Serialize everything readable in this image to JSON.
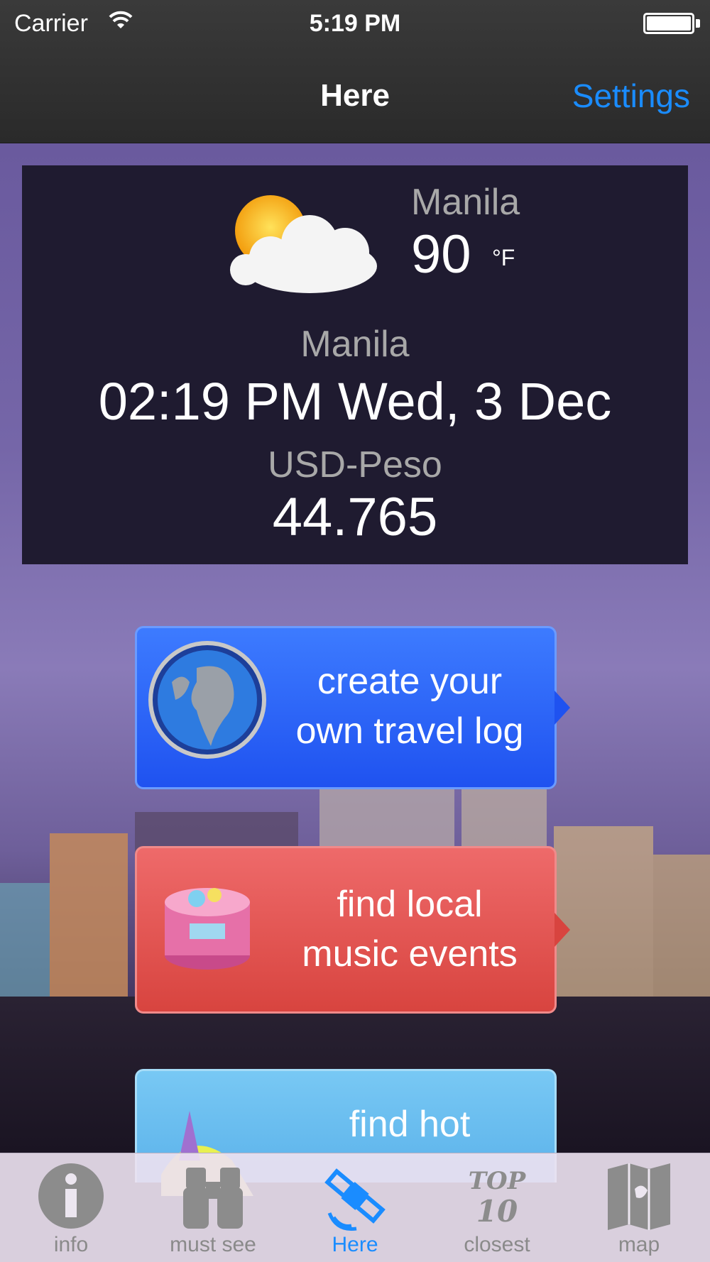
{
  "status_bar": {
    "carrier": "Carrier",
    "time": "5:19 PM"
  },
  "nav": {
    "title": "Here",
    "settings_label": "Settings"
  },
  "weather": {
    "city": "Manila",
    "temperature": "90",
    "unit": "°F",
    "icon": "partly-cloudy-icon"
  },
  "local_time": {
    "city": "Manila",
    "datetime": "02:19 PM Wed, 3 Dec"
  },
  "currency": {
    "label": "USD-Peso",
    "rate": "44.765"
  },
  "actions": [
    {
      "line1": "create your",
      "line2": "own travel log",
      "icon": "globe-icon",
      "color": "#2c66f8"
    },
    {
      "line1": "find local",
      "line2": "music events",
      "icon": "music-box-icon",
      "color": "#e2544f"
    },
    {
      "line1": "find hot",
      "line2": "",
      "icon": "landmark-icon",
      "color": "#68bdf0"
    }
  ],
  "tabs": [
    {
      "label": "info",
      "icon": "info-icon",
      "active": false
    },
    {
      "label": "must see",
      "icon": "binoculars-icon",
      "active": false
    },
    {
      "label": "Here",
      "icon": "satellite-icon",
      "active": true
    },
    {
      "label": "closest",
      "icon": "top-10-icon",
      "active": false
    },
    {
      "label": "map",
      "icon": "map-icon",
      "active": false
    }
  ],
  "colors": {
    "accent": "#1a8cff",
    "card_bg": "#1f1b30",
    "navbar_bg": "#333333"
  }
}
